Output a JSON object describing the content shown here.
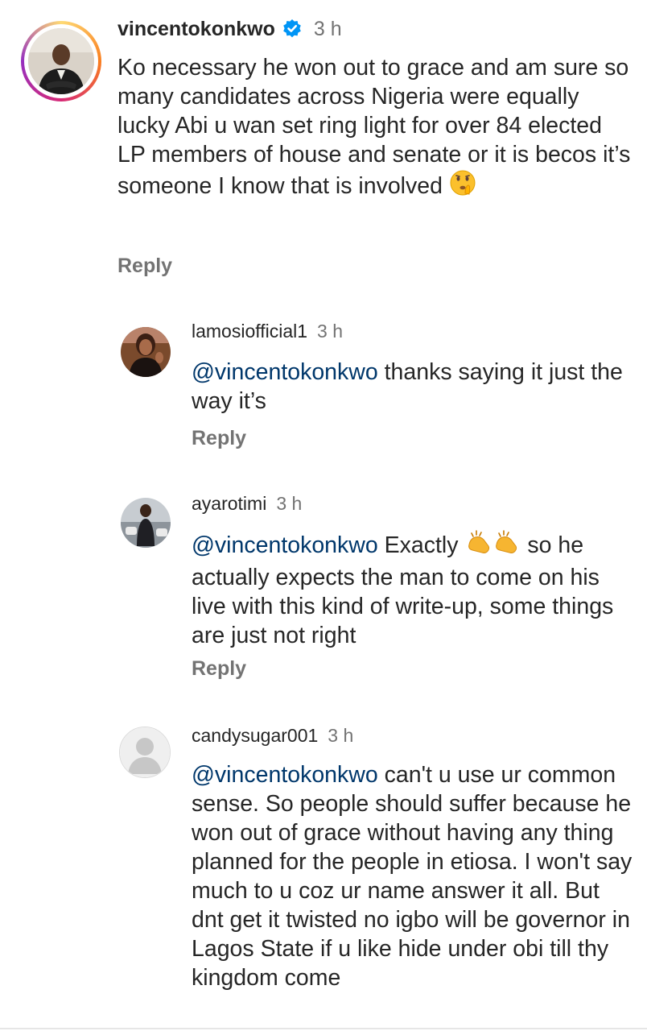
{
  "comments": [
    {
      "username": "vincentokonkwo",
      "verified": true,
      "time": "3 h",
      "text": "Ko necessary he won out to grace and am sure so many candidates across Nigeria were equally lucky Abi u wan set ring light for over 84 elected LP members of house and senate or it is becos it’s someone I know that is involved",
      "emoji": "shushing-face",
      "reply_label": "Reply"
    },
    {
      "username": "lamosiofficial1",
      "time": "3 h",
      "mention": "@vincentokonkwo",
      "text": " thanks saying it just the way it’s",
      "reply_label": "Reply"
    },
    {
      "username": "ayarotimi",
      "time": "3 h",
      "mention": "@vincentokonkwo",
      "text_before": " Exactly ",
      "emoji": "clapping-hands",
      "text_after": " so he actually expects the man to come on his live with this kind of write-up, some things are just not right",
      "reply_label": "Reply"
    },
    {
      "username": "candysugar001",
      "time": "3 h",
      "mention": "@vincentokonkwo",
      "text": " can't u use ur common sense. So people should suffer because he won out of grace without having any thing planned for the people in etiosa. I won't say much to u coz ur name answer it all. But dnt get it twisted no igbo will be governor in Lagos State if u like hide under obi till thy kingdom come"
    }
  ],
  "colors": {
    "mention": "#00376b",
    "verified": "#0095f6",
    "muted": "#737373",
    "story_ring": [
      "#feda75",
      "#fa7e1e",
      "#d62976",
      "#962fbf"
    ]
  }
}
